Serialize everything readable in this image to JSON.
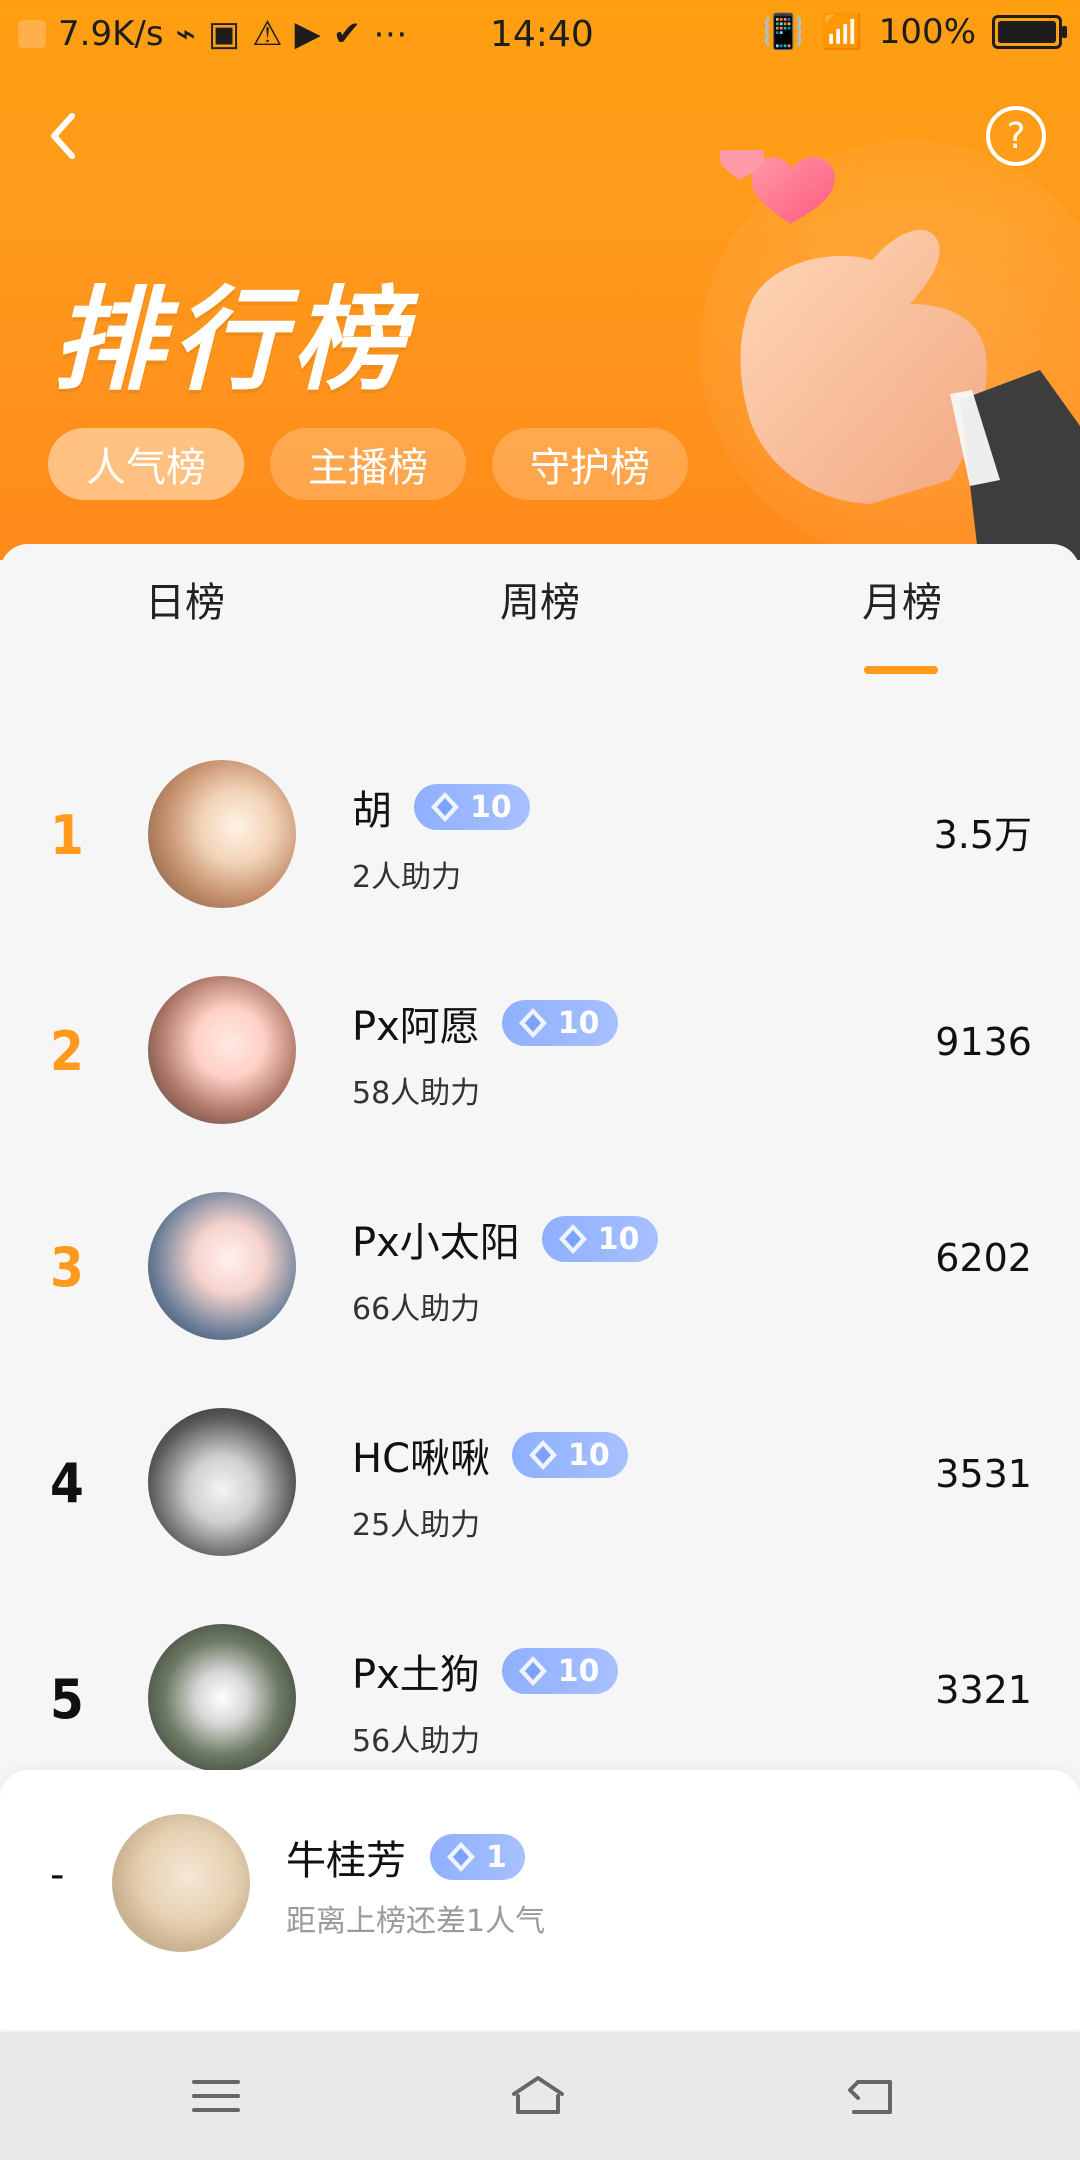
{
  "status_bar": {
    "speed": "7.9K/s",
    "time": "14:40",
    "battery": "100%"
  },
  "header": {
    "title": "排行榜",
    "help_label": "?",
    "categories": [
      {
        "label": "人气榜",
        "active": true
      },
      {
        "label": "主播榜",
        "active": false
      },
      {
        "label": "守护榜",
        "active": false
      }
    ]
  },
  "period_tabs": [
    {
      "label": "日榜",
      "active": false
    },
    {
      "label": "周榜",
      "active": false
    },
    {
      "label": "月榜",
      "active": true
    }
  ],
  "ranking": [
    {
      "rank": "1",
      "name": "胡",
      "level": "10",
      "supporters": "2人助力",
      "score": "3.5万"
    },
    {
      "rank": "2",
      "name": "Px阿愿",
      "level": "10",
      "supporters": "58人助力",
      "score": "9136"
    },
    {
      "rank": "3",
      "name": "Px小太阳",
      "level": "10",
      "supporters": "66人助力",
      "score": "6202"
    },
    {
      "rank": "4",
      "name": "HC啾啾",
      "level": "10",
      "supporters": "25人助力",
      "score": "3531"
    },
    {
      "rank": "5",
      "name": "Px土狗",
      "level": "10",
      "supporters": "56人助力",
      "score": "3321"
    }
  ],
  "my_entry": {
    "rank": "-",
    "name": "牛桂芳",
    "level": "1",
    "note": "距离上榜还差1人气"
  },
  "colors": {
    "accent": "#ff9a1d",
    "badge": "#9db8ff"
  }
}
